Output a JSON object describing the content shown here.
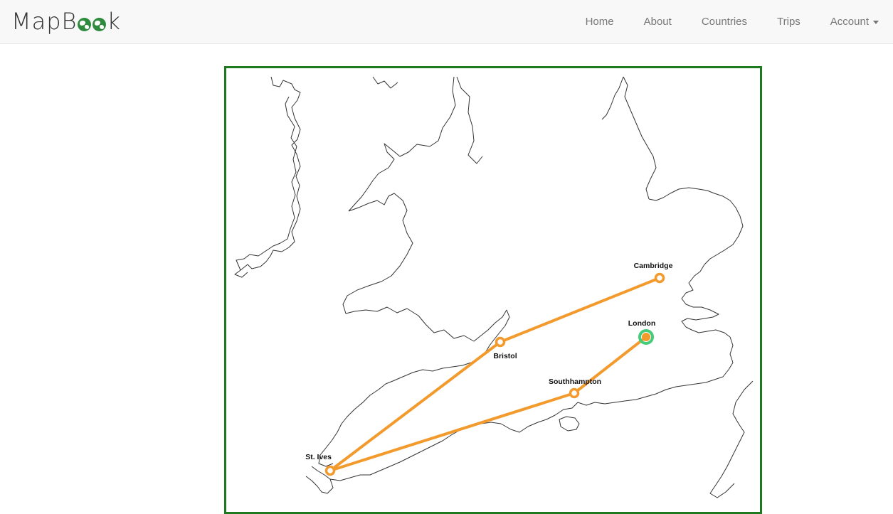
{
  "brand": {
    "text_before": "MapB",
    "text_after": "k"
  },
  "nav": {
    "items": [
      {
        "label": "Home"
      },
      {
        "label": "About"
      },
      {
        "label": "Countries"
      },
      {
        "label": "Trips"
      }
    ],
    "account_label": "Account"
  },
  "colors": {
    "route": "#f39a2d",
    "home_marker": "#45cc7a",
    "map_border": "#1f7a1f",
    "brand_globe": "#2e8b3e"
  },
  "map": {
    "home_city": "London",
    "cities": [
      {
        "name": "Cambridge"
      },
      {
        "name": "London"
      },
      {
        "name": "Bristol"
      },
      {
        "name": "Southhampton"
      },
      {
        "name": "St. Ives"
      }
    ],
    "routes": [
      {
        "from": "London",
        "to": "Southhampton"
      },
      {
        "from": "Southhampton",
        "to": "St. Ives"
      },
      {
        "from": "St. Ives",
        "to": "Bristol"
      },
      {
        "from": "Bristol",
        "to": "Cambridge"
      }
    ]
  }
}
